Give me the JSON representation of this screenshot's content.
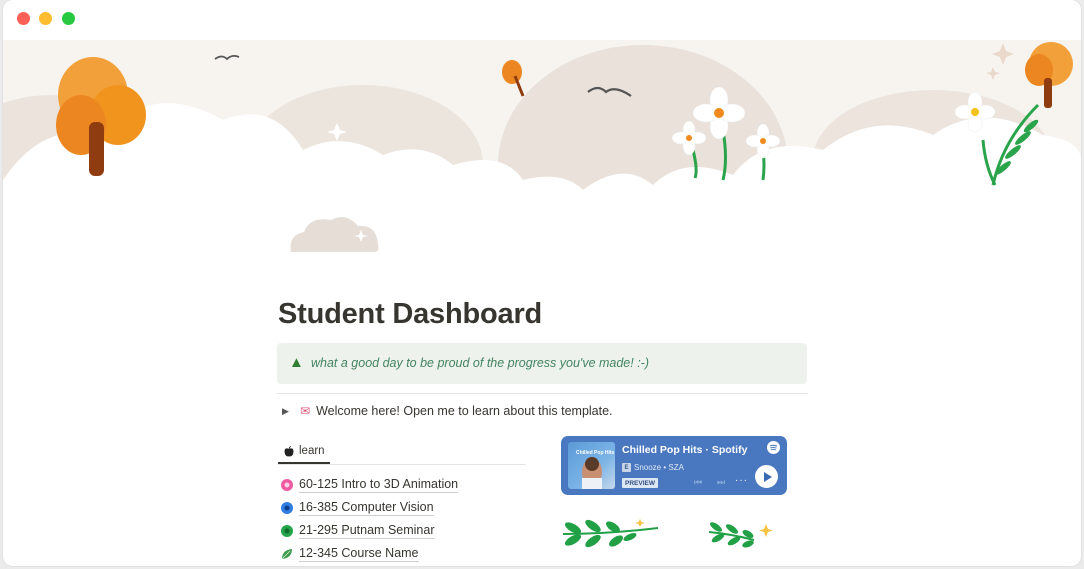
{
  "window": {
    "controls": [
      "close",
      "minimize",
      "zoom"
    ],
    "colors": {
      "close": "#fe5f57",
      "minimize": "#febc2e",
      "zoom": "#28c840"
    }
  },
  "page": {
    "title": "Student Dashboard",
    "callout": {
      "icon": "evergreen-tree-icon",
      "text": "what a good day to be proud of the progress you've made! :-)",
      "bg": "#edf3ec",
      "text_color": "#448361"
    },
    "toggle": {
      "icon": "love-letter-icon",
      "text": "Welcome here! Open me to learn about this template."
    },
    "tabs": [
      {
        "label": "learn",
        "icon": "apple-icon",
        "active": true
      }
    ],
    "courses": [
      {
        "label": "60-125 Intro to 3D Animation",
        "icon": "pink-flower-icon"
      },
      {
        "label": "16-385 Computer Vision",
        "icon": "blue-flower-icon"
      },
      {
        "label": "21-295 Putnam Seminar",
        "icon": "green-flower-icon"
      },
      {
        "label": "12-345 Course Name",
        "icon": "leaf-icon"
      }
    ],
    "spotify": {
      "title": "Chilled Pop Hits · Spotify",
      "explicit": "E",
      "subtitle": "Snooze • SZA",
      "preview_label": "PREVIEW",
      "art_label": "Chilled Pop Hits",
      "bg": "#4a78c0"
    }
  }
}
